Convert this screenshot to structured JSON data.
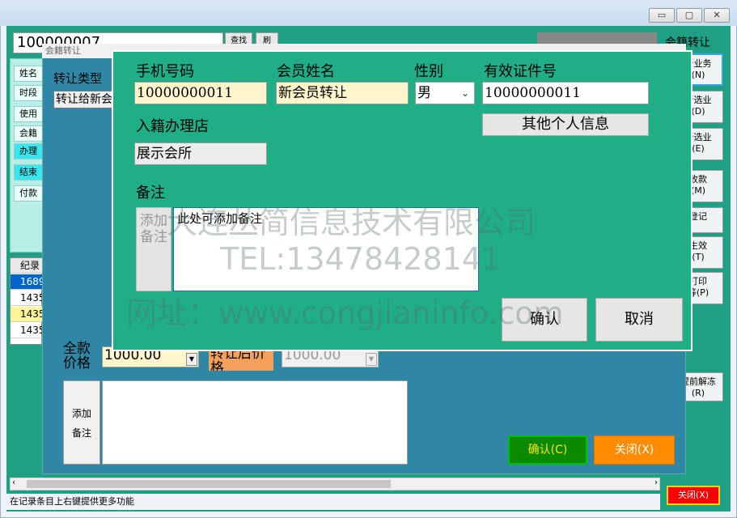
{
  "window": {
    "minimize": "▭",
    "maximize": "▢",
    "close": "✕"
  },
  "background": {
    "search_value": "100000007",
    "query_btn": "查找",
    "second_btn": "刷",
    "left_rows": [
      "姓名",
      "时段",
      "使用",
      "会籍",
      "办理",
      "结束",
      "付款"
    ],
    "grid_header": "纪录",
    "grid_rows": [
      "1689",
      "1435",
      "1435",
      "1435"
    ],
    "status_text": "在记录条目上右键提供更多功能",
    "close_label": "关闭(X)"
  },
  "right_panel": {
    "title": "会籍转让",
    "buttons": [
      "新业务\n(N)",
      "新选业\n(D)",
      "新选业\n(E)",
      "收款\n(M)",
      "登记",
      "生效\n(T)",
      "打印\n等(P)",
      "提前解冻\n(R)"
    ]
  },
  "transfer_dialog": {
    "title": "会籍转让",
    "type_label": "转让类型",
    "type_value": "转让给新会",
    "full_price_label": "全款价格",
    "full_price_value": "1000.00",
    "after_price_label": "转让后价格",
    "after_price_value": "1000.00",
    "add_note": "添加\n备注",
    "confirm": "确认(C)",
    "close": "关闭(X)"
  },
  "member_dialog": {
    "phone_label": "手机号码",
    "phone_value": "10000000011",
    "name_label": "会员姓名",
    "name_value": "新会员转让",
    "gender_label": "性别",
    "gender_value": "男",
    "id_label": "有效证件号",
    "id_value": "10000000011",
    "store_label": "入籍办理店",
    "store_value": "展示会所",
    "other_info_btn": "其他个人信息",
    "note_label": "备注",
    "add_note_btn": "添加备注",
    "note_placeholder": "此处可添加备注",
    "confirm": "确认",
    "cancel": "取消"
  },
  "watermark": {
    "line1": "大连丛简信息技术有限公司",
    "line2": "TEL:13478428141",
    "line3": "网址：www.congjianinfo.com"
  }
}
